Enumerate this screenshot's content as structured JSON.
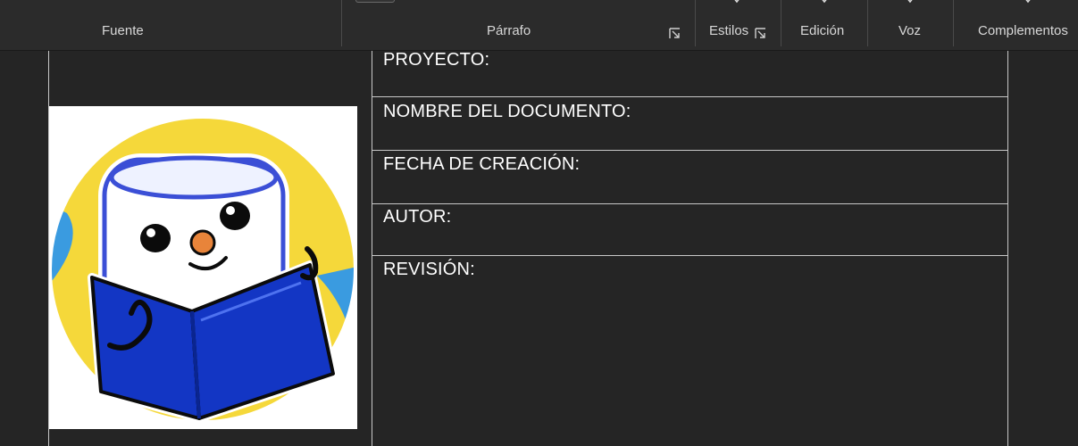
{
  "ribbon": {
    "groups": {
      "fuente": "Fuente",
      "parrafo": "Párrafo",
      "estilos": "Estilos",
      "edicion": "Edición",
      "voz": "Voz",
      "complementos": "Complementos"
    }
  },
  "document": {
    "table_rows": [
      "PROYECTO:",
      "NOMBRE DEL DOCUMENTO:",
      "FECHA DE CREACIÓN:",
      "AUTOR:",
      "REVISIÓN:"
    ],
    "logo": {
      "icon": "reading-marshmallow-mascot-icon",
      "colors": {
        "background_circle": "#f5d83a",
        "book": "#1336c4",
        "outline": "#0b0b0b",
        "face": "#ffffff",
        "nose": "#e8843a"
      }
    }
  }
}
